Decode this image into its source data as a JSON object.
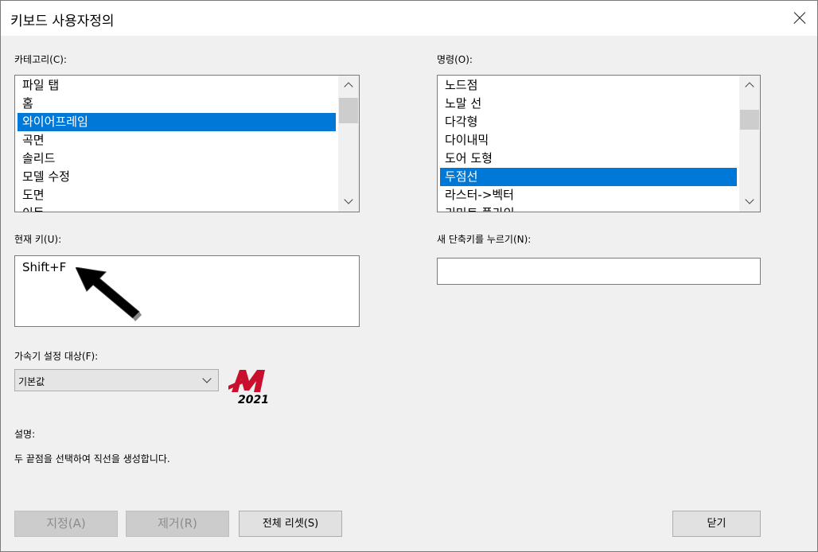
{
  "window": {
    "title": "키보드 사용자정의"
  },
  "category": {
    "label": "카테고리(C):",
    "items": [
      "파일 탭",
      "홈",
      "와이어프레임",
      "곡면",
      "솔리드",
      "모델 수정",
      "도면",
      "이동"
    ],
    "selected_index": 2,
    "scroll_position": 0.0
  },
  "command": {
    "label": "명령(O):",
    "items": [
      "노드점",
      "노말 선",
      "다각형",
      "다이내믹",
      "도어 도형",
      "두점선",
      "라스터->벡터",
      "리미트 플라인"
    ],
    "selected_index": 5,
    "scroll_position": 0.2
  },
  "current_key": {
    "label": "현재 키(U):",
    "value": "Shift+F"
  },
  "new_shortcut": {
    "label": "새 단축키를 누르기(N):",
    "value": ""
  },
  "accelerator": {
    "label": "가속기 설정 대상(F):",
    "selected": "기본값"
  },
  "description": {
    "label": "설명:",
    "text": "두 끝점을 선택하여 직선을 생성합니다."
  },
  "logo": {
    "year": "2021"
  },
  "buttons": {
    "assign": "지정(A)",
    "remove": "제거(R)",
    "reset_all": "전체 리셋(S)",
    "close": "닫기"
  },
  "colors": {
    "selection": "#0078d7",
    "logo_red": "#c8102e"
  }
}
